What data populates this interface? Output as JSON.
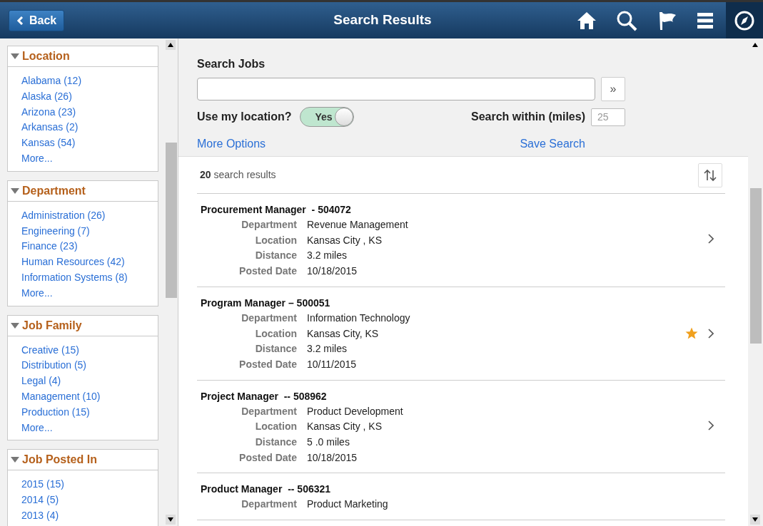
{
  "header": {
    "back": "Back",
    "title": "Search Results"
  },
  "filters": [
    {
      "title": "Location",
      "expanded": true,
      "items": [
        "Alabama (12)",
        "Alaska (26)",
        "Arizona (23)",
        "Arkansas (2)",
        "Kansas (54)"
      ],
      "more": "More..."
    },
    {
      "title": "Department",
      "expanded": true,
      "items": [
        "Administration (26)",
        "Engineering (7)",
        "Finance (23)",
        "Human Resources (42)",
        "Information Systems (8)"
      ],
      "more": "More..."
    },
    {
      "title": "Job Family",
      "expanded": true,
      "items": [
        "Creative (15)",
        "Distribution (5)",
        "Legal (4)",
        "Management (10)",
        "Production (15)"
      ],
      "more": "More..."
    },
    {
      "title": "Job Posted In",
      "expanded": true,
      "items": [
        "2015 (15)",
        "2014 (5)",
        "2013 (4)"
      ]
    }
  ],
  "search": {
    "label": "Search Jobs",
    "go": "»",
    "location_label": "Use my location?",
    "toggle": {
      "label": "Yes",
      "on": true
    },
    "within_label": "Search within (miles)",
    "within_placeholder": "25",
    "more_options": "More Options",
    "save_search": "Save Search"
  },
  "results_count": {
    "count": "20",
    "label": "search results"
  },
  "results": [
    {
      "title": "Procurement Manager  - 504072",
      "favorite": false,
      "fields": [
        {
          "label": "Department",
          "value": "Revenue Management"
        },
        {
          "label": "Location",
          "value": "Kansas City , KS"
        },
        {
          "label": "Distance",
          "value": "3.2 miles"
        },
        {
          "label": "Posted Date",
          "value": "10/18/2015"
        }
      ]
    },
    {
      "title": "Program Manager – 500051",
      "favorite": true,
      "fields": [
        {
          "label": "Department",
          "value": "Information Technology"
        },
        {
          "label": "Location",
          "value": "Kansas City, KS"
        },
        {
          "label": "Distance",
          "value": "3.2 miles"
        },
        {
          "label": "Posted Date",
          "value": "10/11/2015"
        }
      ]
    },
    {
      "title": "Project Manager  -- 508962",
      "favorite": false,
      "fields": [
        {
          "label": "Department",
          "value": "Product Development"
        },
        {
          "label": "Location",
          "value": "Kansas City , KS"
        },
        {
          "label": "Distance",
          "value": "5 .0 miles"
        },
        {
          "label": "Posted Date",
          "value": "10/18/2015"
        }
      ]
    },
    {
      "title": "Product Manager  -- 506321",
      "favorite": false,
      "fields": [
        {
          "label": "Department",
          "value": "Product Marketing"
        }
      ]
    }
  ]
}
